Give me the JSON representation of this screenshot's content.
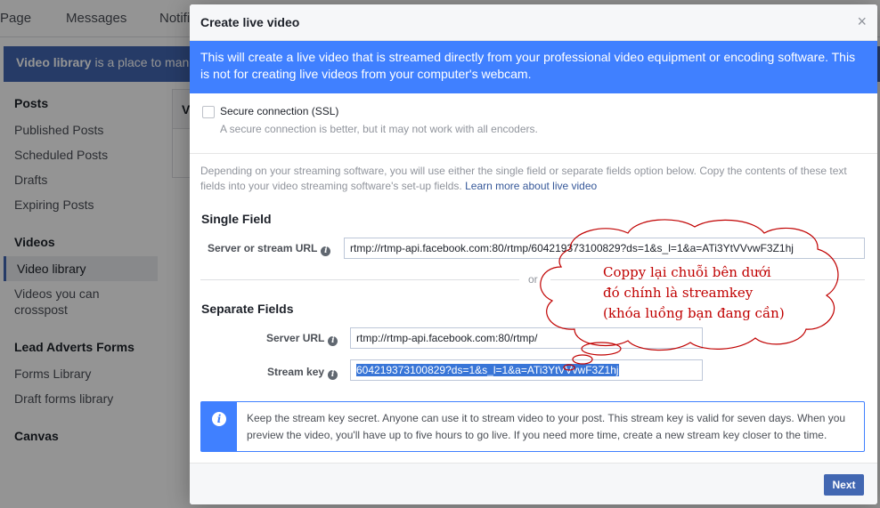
{
  "background": {
    "nav": {
      "page": "Page",
      "messages": "Messages",
      "notifications": "Notifi"
    },
    "banner": {
      "bold": "Video library",
      "rest": " is a place to man"
    },
    "sidebar": {
      "posts_title": "Posts",
      "posts_items": [
        "Published Posts",
        "Scheduled Posts",
        "Drafts",
        "Expiring Posts"
      ],
      "videos_title": "Videos",
      "videos_items": [
        "Video library",
        "Videos you can crosspost"
      ],
      "lead_title": "Lead Adverts Forms",
      "lead_items": [
        "Forms Library",
        "Draft forms library"
      ],
      "canvas_title": "Canvas"
    },
    "card_letter": "V"
  },
  "modal": {
    "title": "Create live video",
    "close": "×",
    "alert": "This will create a live video that is streamed directly from your professional video equipment or encoding software. This is not for creating live videos from your computer's webcam.",
    "ssl_label": "Secure connection (SSL)",
    "ssl_hint": "A secure connection is better, but it may not work with all encoders.",
    "intro": "Depending on your streaming software, you will use either the single field or separate fields option below. Copy the contents of these text fields into your video streaming software's set-up fields. ",
    "intro_link": "Learn more about live video",
    "single_title": "Single Field",
    "server_or_stream_label": "Server or stream URL",
    "server_or_stream_value": "rtmp://rtmp-api.facebook.com:80/rtmp/604219373100829?ds=1&s_l=1&a=ATi3YtVVvwF3Z1hj",
    "or": "or",
    "separate_title": "Separate Fields",
    "server_url_label": "Server URL",
    "server_url_value": "rtmp://rtmp-api.facebook.com:80/rtmp/",
    "stream_key_label": "Stream key",
    "stream_key_value": "604219373100829?ds=1&s_l=1&a=ATi3YtVVvwF3Z1hj",
    "notice": "Keep the stream key secret. Anyone can use it to stream video to your post. This stream key is valid for seven days. When you preview the video, you'll have up to five hours to go live. If you need more time, create a new stream key closer to the time.",
    "next": "Next"
  },
  "annotation": {
    "lines": [
      "Coppy lại chuỗi bên dưới",
      "đó chính là streamkey",
      "(khóa luồng bạn đang cần)"
    ],
    "color": "#c00000"
  },
  "colors": {
    "brand": "#4267b2",
    "alert_blue": "#4080ff",
    "link": "#365899",
    "selection": "#3875d7"
  }
}
